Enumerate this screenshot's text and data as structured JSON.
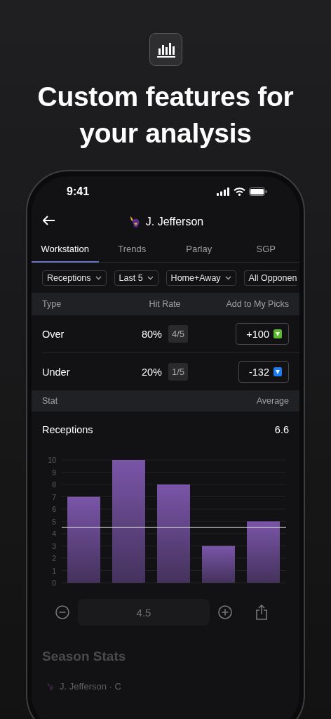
{
  "headline": "Custom features for your analysis",
  "status_bar": {
    "time": "9:41"
  },
  "header": {
    "title": "J. Jefferson"
  },
  "tabs": [
    {
      "label": "Workstation",
      "selected": true
    },
    {
      "label": "Trends",
      "selected": false
    },
    {
      "label": "Parlay",
      "selected": false
    },
    {
      "label": "SGP",
      "selected": false
    }
  ],
  "filters": [
    {
      "label": "Receptions"
    },
    {
      "label": "Last 5"
    },
    {
      "label": "Home+Away"
    },
    {
      "label": "All Opponen"
    }
  ],
  "picks_table": {
    "columns": [
      "Type",
      "Hit Rate",
      "Add to My Picks"
    ],
    "rows": [
      {
        "type": "Over",
        "hit_rate": "80%",
        "record": "4/5",
        "odds": "+100",
        "color": "#5cb82f"
      },
      {
        "type": "Under",
        "hit_rate": "20%",
        "record": "1/5",
        "odds": "-132",
        "color": "#1c7cf0"
      }
    ]
  },
  "stat_table": {
    "columns": [
      "Stat",
      "Average"
    ],
    "rows": [
      {
        "stat": "Receptions",
        "average": "6.6"
      }
    ]
  },
  "chart_data": {
    "type": "bar",
    "values": [
      7,
      10,
      8,
      3,
      5
    ],
    "ylim": [
      0,
      10
    ],
    "yticks": [
      0,
      1,
      2,
      3,
      4,
      5,
      6,
      7,
      8,
      9,
      10
    ],
    "grid": true,
    "ref_lines": [
      {
        "axis": "y",
        "value": 4.5
      }
    ]
  },
  "line_control": {
    "value": "4.5"
  },
  "season_stats": {
    "title": "Season Stats",
    "player_line": "J. Jefferson · C"
  }
}
